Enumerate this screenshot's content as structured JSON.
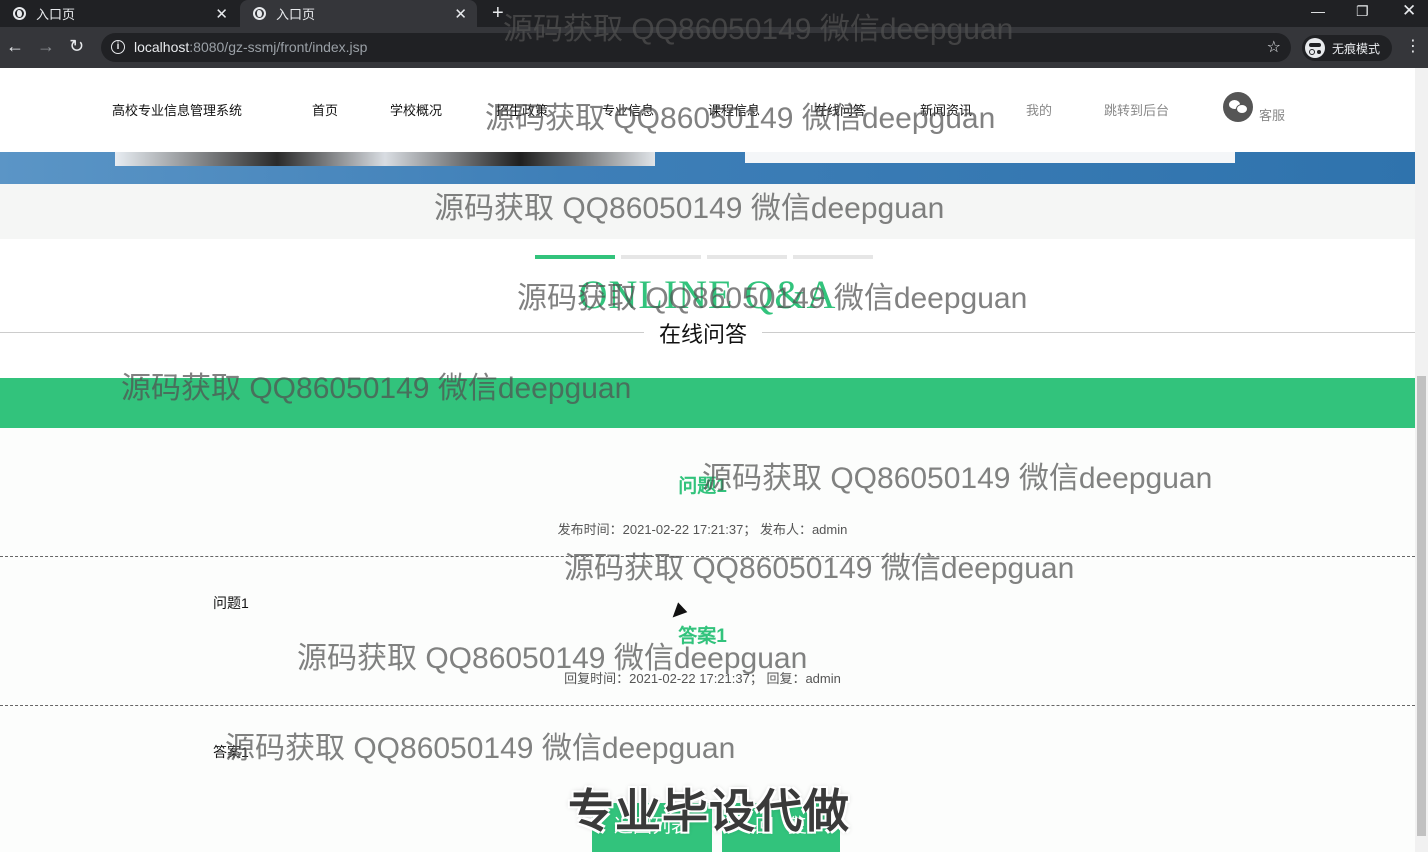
{
  "browser": {
    "tabs": [
      {
        "title": "入口页"
      },
      {
        "title": "入口页"
      }
    ],
    "url_host": "localhost",
    "url_rest": ":8080/gz-ssmj/front/index.jsp",
    "incognito_label": "无痕模式"
  },
  "nav": {
    "brand": "高校专业信息管理系统",
    "items": [
      "首页",
      "学校概况",
      "招生政策",
      "专业信息",
      "课程信息",
      "在线问答",
      "新闻资讯",
      "我的",
      "跳转到后台"
    ],
    "service": "客服"
  },
  "carousel": {
    "slide_count": 4,
    "active_index": 0
  },
  "section": {
    "title_en": "ONLINE Q&A",
    "title_cn": "在线问答"
  },
  "detail": {
    "question_title": "问题1",
    "question_meta": "发布时间：2021-02-22 17:21:37；  发布人：admin",
    "question_body": "问题1",
    "answer_title": "答案1",
    "answer_meta": "回复时间：2021-02-22 17:21:37；  回复：admin",
    "answer_body": "答案1",
    "back_button": "返回列表",
    "reply_button": "回复"
  },
  "watermarks": {
    "text": "源码获取 QQ86050149 微信deepguan",
    "overlay": "专业毕设代做"
  },
  "colors": {
    "accent": "#32c37c",
    "chrome_dark": "#202124",
    "chrome_mid": "#35363a"
  }
}
